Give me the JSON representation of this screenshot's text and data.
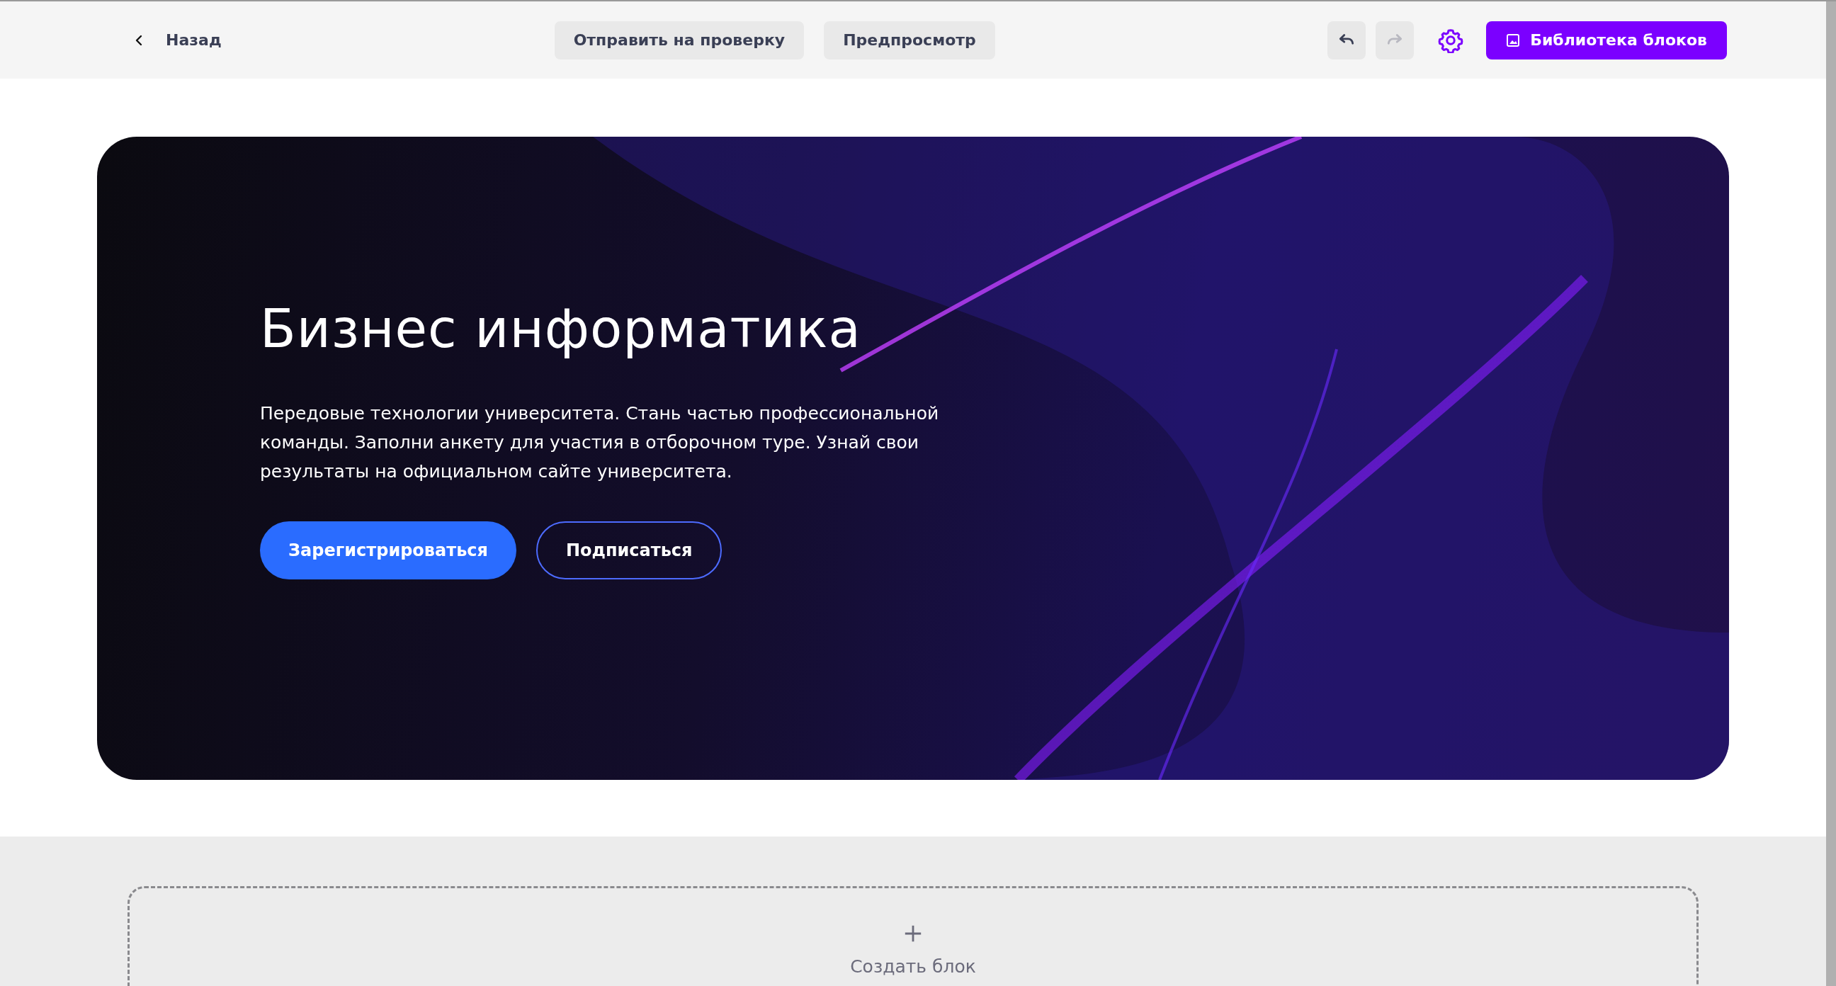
{
  "toolbar": {
    "back": {
      "label": "Назад"
    },
    "actions": [
      {
        "label": "Отправить на проверку"
      },
      {
        "label": "Предпросмотр"
      }
    ],
    "history": [
      {
        "kind": "undo",
        "disabled": false
      },
      {
        "kind": "redo",
        "disabled": true
      }
    ],
    "library_button": {
      "label": "Библиотека блоков"
    }
  },
  "hero": {
    "title": "Бизнес информатика",
    "text": "Передовые технологии университета. Стань частью профессиональной команды. Заполни анкету для участия в отборочном туре. Узнай свои результаты на официальном сайте университета.",
    "buttons": [
      {
        "kind": "primary",
        "label": "Зарегистрироваться"
      },
      {
        "kind": "outline",
        "label": "Подписаться"
      }
    ]
  },
  "add_block": {
    "label": "Создать блок"
  }
}
